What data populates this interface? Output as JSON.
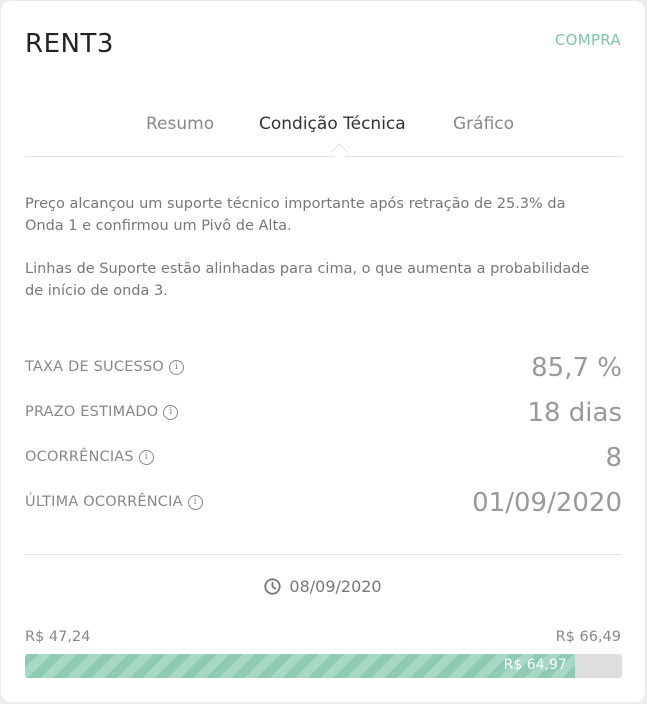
{
  "header": {
    "ticker": "RENT3",
    "signal": "COMPRA"
  },
  "tabs": [
    {
      "label": "Resumo",
      "active": false
    },
    {
      "label": "Condição Técnica",
      "active": true
    },
    {
      "label": "Gráfico",
      "active": false
    }
  ],
  "description": {
    "p1": "Preço alcançou um suporte técnico importante após retração de 25.3% da Onda 1 e confirmou um Pivô de Alta.",
    "p2": "Linhas de Suporte estão alinhadas para cima, o que aumenta a probabilidade de início de onda 3."
  },
  "stats": [
    {
      "label": "TAXA DE SUCESSO",
      "value": "85,7 %"
    },
    {
      "label": "PRAZO ESTIMADO",
      "value": "18 dias"
    },
    {
      "label": "OCORRÊNCIAS",
      "value": "8"
    },
    {
      "label": "ÚLTIMA OCORRÊNCIA",
      "value": "01/09/2020"
    }
  ],
  "date": "08/09/2020",
  "price_range": {
    "min_label": "R$ 47,24",
    "max_label": "R$ 66,49",
    "current_label": "R$ 64,97",
    "min": 47.24,
    "max": 66.49,
    "current": 64.97
  },
  "colors": {
    "accent": "#7fc6a8",
    "bar_fill": "#8fcbb2",
    "bar_track": "#dedede"
  },
  "icons": {
    "info": "info-circle-icon",
    "clock": "clock-icon"
  }
}
